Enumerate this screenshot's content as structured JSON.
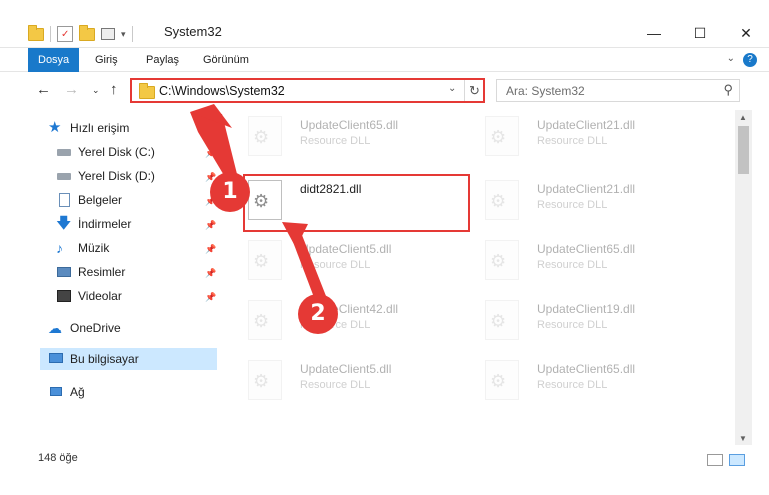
{
  "window": {
    "title": "System32",
    "minimize": "—",
    "maximize": "☐",
    "close": "✕"
  },
  "ribbon": {
    "tabs": [
      "Dosya",
      "Giriş",
      "Paylaş",
      "Görünüm"
    ],
    "help": "?"
  },
  "address": {
    "path": "C:\\Windows\\System32",
    "search_placeholder": "Ara: System32"
  },
  "nav": {
    "quick_access": "Hızlı erişim",
    "items": [
      {
        "label": "Yerel Disk (C:)",
        "icon": "drive-icon",
        "pinned": true
      },
      {
        "label": "Yerel Disk (D:)",
        "icon": "drive-icon",
        "pinned": true
      },
      {
        "label": "Belgeler",
        "icon": "documents-icon",
        "pinned": true
      },
      {
        "label": "İndirmeler",
        "icon": "downloads-icon",
        "pinned": true
      },
      {
        "label": "Müzik",
        "icon": "music-icon",
        "pinned": true
      },
      {
        "label": "Resimler",
        "icon": "pictures-icon",
        "pinned": true
      },
      {
        "label": "Videolar",
        "icon": "videos-icon",
        "pinned": true
      }
    ],
    "onedrive": "OneDrive",
    "this_pc": "Bu bilgisayar",
    "network": "Ağ"
  },
  "files": [
    {
      "name": "UpdateClient65.dll",
      "type": "Resource DLL"
    },
    {
      "name": "UpdateClient21.dll",
      "type": "Resource DLL"
    },
    {
      "name": "didt2821.dll",
      "type": ""
    },
    {
      "name": "UpdateClient21.dll",
      "type": "Resource DLL"
    },
    {
      "name": "UpdateClient5.dll",
      "type": "Resource DLL"
    },
    {
      "name": "UpdateClient65.dll",
      "type": "Resource DLL"
    },
    {
      "name": "UpdateClient42.dll",
      "type": "Resource DLL"
    },
    {
      "name": "UpdateClient19.dll",
      "type": "Resource DLL"
    },
    {
      "name": "UpdateClient5.dll",
      "type": "Resource DLL"
    },
    {
      "name": "UpdateClient65.dll",
      "type": "Resource DLL"
    }
  ],
  "status": {
    "count": "148 öğe"
  },
  "annotations": {
    "step1": "1",
    "step2": "2",
    "color": "#e53935"
  }
}
